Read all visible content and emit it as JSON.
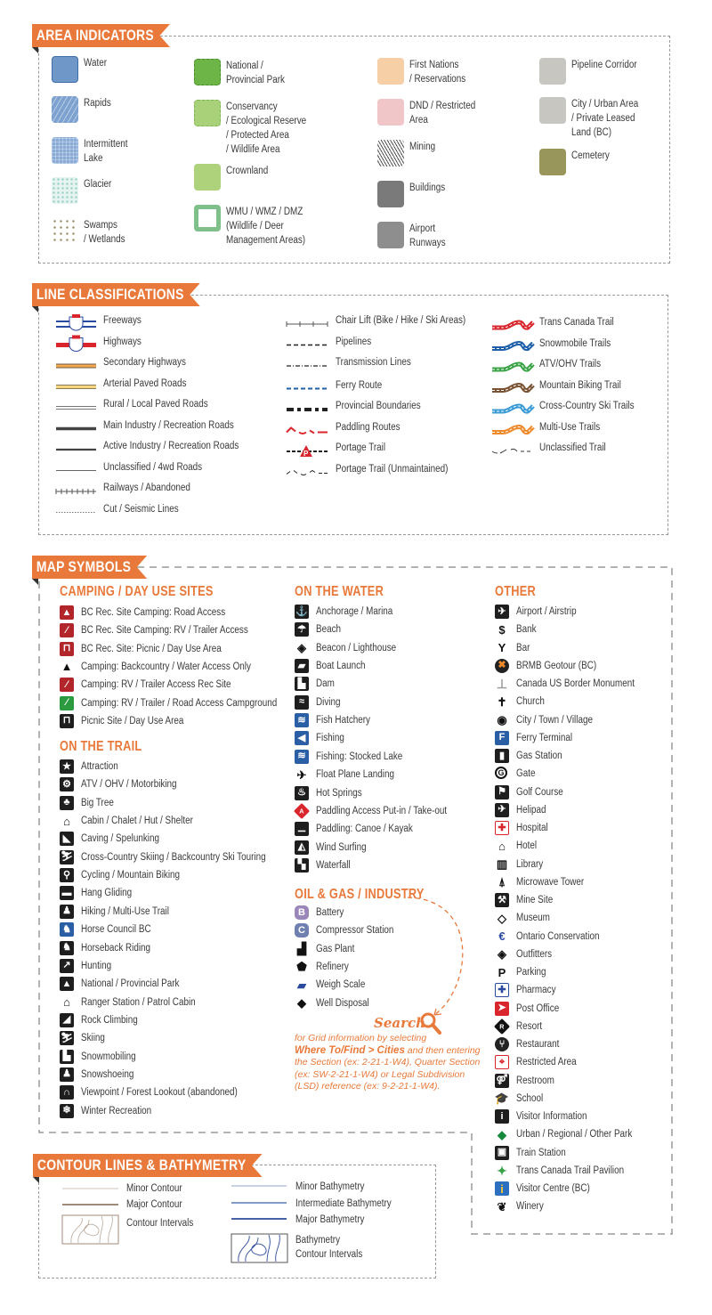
{
  "area_indicators": {
    "title": "AREA INDICATORS",
    "items": [
      {
        "label": "Water",
        "color": "#6f97c8",
        "border": "#3d6ea8"
      },
      {
        "label": "Rapids",
        "color": "#7ea2d0"
      },
      {
        "label": "Intermittent\nLake",
        "color": "#8aabd6"
      },
      {
        "label": "Glacier",
        "color": "#e6f3f0"
      },
      {
        "label": "Swamps\n/ Wetlands",
        "color": "#ffffff"
      },
      {
        "label": "National /\nProvincial Park",
        "color": "#6db546",
        "border": "#4a8a30"
      },
      {
        "label": "Conservancy\n/ Ecological Reserve\n/ Protected Area\n/ Wildlife Area",
        "color": "#a8d17a",
        "border": "#7fb552"
      },
      {
        "label": "Crownland",
        "color": "#aed27c"
      },
      {
        "label": "WMU / WMZ / DMZ\n(Wildlife / Deer\nManagement Areas)",
        "color": "#7fbf8a"
      },
      {
        "label": "First Nations\n/ Reservations",
        "color": "#f6cfa6"
      },
      {
        "label": "DND / Restricted\nArea",
        "color": "#f0c6c8"
      },
      {
        "label": "Mining",
        "color": "#cfcfcf"
      },
      {
        "label": "Buildings",
        "color": "#7a7a7a"
      },
      {
        "label": "Airport\nRunways",
        "color": "#8e8e8e"
      },
      {
        "label": "Pipeline Corridor",
        "color": "#c7c6c1"
      },
      {
        "label": "City / Urban Area\n/ Private Leased\nLand (BC)",
        "color": "#c7c6c1"
      },
      {
        "label": "Cemetery",
        "color": "#98965a"
      }
    ]
  },
  "line_classifications": {
    "title": "LINE CLASSIFICATIONS",
    "col1": [
      "Freeways",
      "Highways",
      "Secondary Highways",
      "Arterial Paved Roads",
      "Rural / Local Paved Roads",
      "Main Industry / Recreation Roads",
      "Active Industry / Recreation Roads",
      "Unclassified / 4wd Roads",
      "Railways / Abandoned",
      "Cut / Seismic Lines"
    ],
    "col2": [
      "Chair Lift (Bike / Hike / Ski Areas)",
      "Pipelines",
      "Transmission Lines",
      "Ferry Route",
      "Provincial Boundaries",
      "Paddling Routes",
      "Portage Trail",
      "Portage Trail (Unmaintained)"
    ],
    "col3": [
      {
        "label": "Trans Canada Trail",
        "color": "#d9262c"
      },
      {
        "label": "Snowmobile Trails",
        "color": "#1d5fa8"
      },
      {
        "label": "ATV/OHV Trails",
        "color": "#3aa346"
      },
      {
        "label": "Mountain Biking Trail",
        "color": "#7a5232"
      },
      {
        "label": "Cross-Country Ski Trails",
        "color": "#3a9bd6"
      },
      {
        "label": "Multi-Use Trails",
        "color": "#ef8a2c"
      },
      {
        "label": "Unclassified Trail",
        "color": "#333333"
      }
    ]
  },
  "map_symbols": {
    "title": "MAP SYMBOLS",
    "camping": {
      "title": "CAMPING / DAY USE SITES",
      "items": [
        {
          "label": "BC Rec. Site Camping: Road Access",
          "icon": "tent-icon",
          "glyph": "▲",
          "style": "red"
        },
        {
          "label": "BC Rec. Site Camping: RV / Trailer Access",
          "icon": "rv-tent-icon",
          "glyph": "⁄",
          "style": "red"
        },
        {
          "label": "BC Rec. Site: Picnic / Day Use Area",
          "icon": "picnic-table-icon",
          "glyph": "⊓",
          "style": "red"
        },
        {
          "label": "Camping: Backcountry  / Water Access Only",
          "icon": "tent-outline-icon",
          "glyph": "▲",
          "style": "plain"
        },
        {
          "label": "Camping: RV / Trailer Access Rec Site",
          "icon": "rv-tent-icon",
          "glyph": "⁄",
          "style": "red"
        },
        {
          "label": "Camping: RV / Trailer / Road Access Campground",
          "icon": "rv-tent-icon",
          "glyph": "⁄",
          "style": "green"
        },
        {
          "label": "Picnic Site / Day Use Area",
          "icon": "picnic-table-icon",
          "glyph": "⊓",
          "style": "black"
        }
      ]
    },
    "trail": {
      "title": "ON THE TRAIL",
      "items": [
        {
          "label": "Attraction",
          "icon": "star-icon",
          "glyph": "★",
          "style": "black"
        },
        {
          "label": "ATV / OHV / Motorbiking",
          "icon": "atv-icon",
          "glyph": "⚙",
          "style": "black"
        },
        {
          "label": "Big Tree",
          "icon": "tree-icon",
          "glyph": "♣",
          "style": "black"
        },
        {
          "label": "Cabin / Chalet / Hut / Shelter",
          "icon": "cabin-icon",
          "glyph": "⌂",
          "style": "plain"
        },
        {
          "label": "Caving / Spelunking",
          "icon": "caving-icon",
          "glyph": "◣",
          "style": "black"
        },
        {
          "label": "Cross-Country Skiing / Backcountry Ski Touring",
          "icon": "xc-ski-icon",
          "glyph": "⛷",
          "style": "black"
        },
        {
          "label": "Cycling / Mountain Biking",
          "icon": "bicycle-icon",
          "glyph": "⚲",
          "style": "black"
        },
        {
          "label": "Hang Gliding",
          "icon": "hang-glider-icon",
          "glyph": "▬",
          "style": "black"
        },
        {
          "label": "Hiking / Multi-Use Trail",
          "icon": "hiker-icon",
          "glyph": "♟",
          "style": "black"
        },
        {
          "label": "Horse Council BC",
          "icon": "horse-council-icon",
          "glyph": "♞",
          "style": "blue"
        },
        {
          "label": "Horseback Riding",
          "icon": "horse-rider-icon",
          "glyph": "♞",
          "style": "black"
        },
        {
          "label": "Hunting",
          "icon": "hunter-icon",
          "glyph": "↗",
          "style": "black"
        },
        {
          "label": "National / Provincial Park",
          "icon": "park-trees-icon",
          "glyph": "▲",
          "style": "black"
        },
        {
          "label": "Ranger Station / Patrol Cabin",
          "icon": "ranger-cabin-icon",
          "glyph": "⌂",
          "style": "plain"
        },
        {
          "label": "Rock Climbing",
          "icon": "climber-icon",
          "glyph": "◢",
          "style": "black"
        },
        {
          "label": "Skiing",
          "icon": "skier-icon",
          "glyph": "⛷",
          "style": "black"
        },
        {
          "label": "Snowmobiling",
          "icon": "snowmobile-icon",
          "glyph": "▙",
          "style": "black"
        },
        {
          "label": "Snowshoeing",
          "icon": "snowshoe-icon",
          "glyph": "♟",
          "style": "black"
        },
        {
          "label": "Viewpoint / Forest Lookout (abandoned)",
          "icon": "binoculars-icon",
          "glyph": "∩",
          "style": "black"
        },
        {
          "label": "Winter Recreation",
          "icon": "snowflake-icon",
          "glyph": "❄",
          "style": "black"
        }
      ]
    },
    "water": {
      "title": "ON THE WATER",
      "items": [
        {
          "label": "Anchorage / Marina",
          "icon": "anchor-icon",
          "glyph": "⚓",
          "style": "black"
        },
        {
          "label": "Beach",
          "icon": "beach-umbrella-icon",
          "glyph": "☂",
          "style": "black"
        },
        {
          "label": "Beacon / Lighthouse",
          "icon": "beacon-icon",
          "glyph": "◈",
          "style": "plain"
        },
        {
          "label": "Boat Launch",
          "icon": "boat-launch-icon",
          "glyph": "▰",
          "style": "black"
        },
        {
          "label": "Dam",
          "icon": "dam-icon",
          "glyph": "▙",
          "style": "black"
        },
        {
          "label": "Diving",
          "icon": "diver-icon",
          "glyph": "≈",
          "style": "black"
        },
        {
          "label": "Fish Hatchery",
          "icon": "fish-hatchery-icon",
          "glyph": "≋",
          "style": "blue"
        },
        {
          "label": "Fishing",
          "icon": "fish-icon",
          "glyph": "◀",
          "style": "blue"
        },
        {
          "label": "Fishing: Stocked Lake",
          "icon": "stocked-fish-icon",
          "glyph": "≋",
          "style": "blue"
        },
        {
          "label": "Float Plane Landing",
          "icon": "float-plane-icon",
          "glyph": "✈",
          "style": "plain"
        },
        {
          "label": "Hot Springs",
          "icon": "hot-springs-icon",
          "glyph": "♨",
          "style": "black"
        },
        {
          "label": "Paddling Access Put-in / Take-out",
          "icon": "paddling-access-icon",
          "glyph": "A",
          "style": "diamond-red"
        },
        {
          "label": "Paddling: Canoe / Kayak",
          "icon": "canoe-icon",
          "glyph": "⚊",
          "style": "black"
        },
        {
          "label": "Wind Surfing",
          "icon": "windsurf-icon",
          "glyph": "◭",
          "style": "black"
        },
        {
          "label": "Waterfall",
          "icon": "waterfall-icon",
          "glyph": "▚",
          "style": "black"
        }
      ]
    },
    "oil_gas": {
      "title": "OIL & GAS / INDUSTRY",
      "items": [
        {
          "label": "Battery",
          "icon": "battery-b-icon",
          "glyph": "B",
          "style": "purple"
        },
        {
          "label": "Compressor Station",
          "icon": "compressor-c-icon",
          "glyph": "C",
          "style": "slate"
        },
        {
          "label": "Gas Plant",
          "icon": "gas-plant-icon",
          "glyph": "▟",
          "style": "plain"
        },
        {
          "label": "Refinery",
          "icon": "pentagon-icon",
          "glyph": "⬟",
          "style": "plain"
        },
        {
          "label": "Weigh Scale",
          "icon": "truck-scale-icon",
          "glyph": "▰",
          "style": "plain-blue"
        },
        {
          "label": "Well Disposal",
          "icon": "diamond-outline-icon",
          "glyph": "◆",
          "style": "plain"
        }
      ]
    },
    "search": {
      "title": "Search",
      "line1": "for Grid information by selecting",
      "bold": "Where To/Find > Cities",
      "line2": " and then entering the Section (ex: 2-21-1-W4), Quarter Section (ex: SW-2-21-1-W4) or Legal Subdivision (LSD) reference (ex: 9-2-21-1-W4)."
    },
    "other": {
      "title": "OTHER",
      "items": [
        {
          "label": "Airport / Airstrip",
          "icon": "airplane-icon",
          "glyph": "✈",
          "style": "black"
        },
        {
          "label": "Bank",
          "icon": "dollar-icon",
          "glyph": "$",
          "style": "plain"
        },
        {
          "label": "Bar",
          "icon": "cocktail-icon",
          "glyph": "Y",
          "style": "plain"
        },
        {
          "label": "BRMB Geotour (BC)",
          "icon": "geotour-icon",
          "glyph": "✖",
          "style": "circle-dark"
        },
        {
          "label": "Canada US Border Monument",
          "icon": "monument-icon",
          "glyph": "⊥",
          "style": "plain-grey"
        },
        {
          "label": "Church",
          "icon": "church-icon",
          "glyph": "✝",
          "style": "plain"
        },
        {
          "label": "City / Town / Village",
          "icon": "city-dot-icon",
          "glyph": "◉",
          "style": "plain"
        },
        {
          "label": "Ferry Terminal",
          "icon": "ferry-terminal-icon",
          "glyph": "F",
          "style": "blue"
        },
        {
          "label": "Gas Station",
          "icon": "gas-pump-icon",
          "glyph": "▮",
          "style": "black"
        },
        {
          "label": "Gate",
          "icon": "gate-g-icon",
          "glyph": "G",
          "style": "circle-outline"
        },
        {
          "label": "Golf Course",
          "icon": "golf-flag-icon",
          "glyph": "⚑",
          "style": "black"
        },
        {
          "label": "Helipad",
          "icon": "helicopter-icon",
          "glyph": "✈",
          "style": "black"
        },
        {
          "label": "Hospital",
          "icon": "hospital-cross-icon",
          "glyph": "✚",
          "style": "box-red"
        },
        {
          "label": "Hotel",
          "icon": "hotel-bed-icon",
          "glyph": "⌂",
          "style": "plain"
        },
        {
          "label": "Library",
          "icon": "book-icon",
          "glyph": "▥",
          "style": "plain"
        },
        {
          "label": "Microwave Tower",
          "icon": "tower-icon",
          "glyph": "⍋",
          "style": "plain"
        },
        {
          "label": "Mine Site",
          "icon": "pickaxe-icon",
          "glyph": "⚒",
          "style": "black"
        },
        {
          "label": "Museum",
          "icon": "diamond-outline-icon",
          "glyph": "◇",
          "style": "plain"
        },
        {
          "label": "Ontario Conservation",
          "icon": "ontario-conservation-icon",
          "glyph": "€",
          "style": "plain-blue"
        },
        {
          "label": "Outfitters",
          "icon": "outfitters-icon",
          "glyph": "◈",
          "style": "plain"
        },
        {
          "label": "Parking",
          "icon": "parking-p-icon",
          "glyph": "P",
          "style": "plain"
        },
        {
          "label": "Pharmacy",
          "icon": "pharmacy-cross-icon",
          "glyph": "✚",
          "style": "box-blue"
        },
        {
          "label": "Post Office",
          "icon": "post-office-icon",
          "glyph": "➤",
          "style": "red-solid"
        },
        {
          "label": "Resort",
          "icon": "resort-r-icon",
          "glyph": "R",
          "style": "diamond-black"
        },
        {
          "label": "Restaurant",
          "icon": "fork-knife-icon",
          "glyph": "⑂",
          "style": "circle-dark"
        },
        {
          "label": "Restricted Area",
          "icon": "restricted-icon",
          "glyph": "⌖",
          "style": "box-red"
        },
        {
          "label": "Restroom",
          "icon": "restroom-icon",
          "glyph": "⚤",
          "style": "black"
        },
        {
          "label": "School",
          "icon": "grad-cap-icon",
          "glyph": "🎓",
          "style": "plain"
        },
        {
          "label": "Visitor Information",
          "icon": "info-i-icon",
          "glyph": "i",
          "style": "black"
        },
        {
          "label": "Urban / Regional / Other Park",
          "icon": "green-diamond-icon",
          "glyph": "◆",
          "style": "plain-green"
        },
        {
          "label": "Train Station",
          "icon": "train-icon",
          "glyph": "▣",
          "style": "black"
        },
        {
          "label": "Trans Canada Trail Pavilion",
          "icon": "tct-pavilion-icon",
          "glyph": "✦",
          "style": "plain-multi"
        },
        {
          "label": "Visitor Centre (BC)",
          "icon": "visitor-centre-icon",
          "glyph": "i",
          "style": "blue-yellow"
        },
        {
          "label": "Winery",
          "icon": "grapes-icon",
          "glyph": "❦",
          "style": "plain"
        }
      ]
    }
  },
  "contours": {
    "title": "CONTOUR LINES & BATHYMETRY",
    "left": [
      "Minor Contour",
      "Major Contour",
      "Contour Intervals"
    ],
    "right": [
      "Minor Bathymetry",
      "Intermediate Bathymetry",
      "Major Bathymetry",
      "Bathymetry\nContour Intervals"
    ]
  },
  "colors": {
    "accent": "#e8793a",
    "border": "#9a9a9a"
  }
}
